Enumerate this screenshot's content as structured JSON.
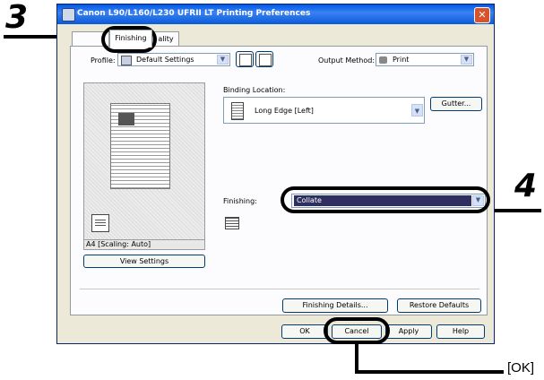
{
  "callouts": {
    "step3": "3",
    "step4": "4",
    "ok_label": "[OK]"
  },
  "window": {
    "title": "Canon L90/L160/L230 UFRII LT Printing Preferences",
    "close_symbol": "✕"
  },
  "tabs": [
    {
      "label": ""
    },
    {
      "label": "Finishing"
    },
    {
      "label": "ality"
    }
  ],
  "profile": {
    "label": "Profile:",
    "value": "Default Settings"
  },
  "output_method": {
    "label": "Output Method:",
    "value": "Print"
  },
  "preview": {
    "caption": "A4 [Scaling: Auto]",
    "view_settings": "View Settings"
  },
  "binding": {
    "label": "Binding Location:",
    "value": "Long Edge [Left]",
    "gutter_button": "Gutter..."
  },
  "finishing": {
    "label": "Finishing:",
    "value": "Collate"
  },
  "panel_buttons": {
    "finishing_details": "Finishing Details...",
    "restore_defaults": "Restore Defaults"
  },
  "dialog_buttons": {
    "ok": "OK",
    "cancel": "Cancel",
    "apply": "Apply",
    "help": "Help"
  },
  "colors": {
    "titlebar": "#0058e6",
    "selected_combo": "#2f2f5f",
    "dialog_bg": "#ece9d8"
  }
}
